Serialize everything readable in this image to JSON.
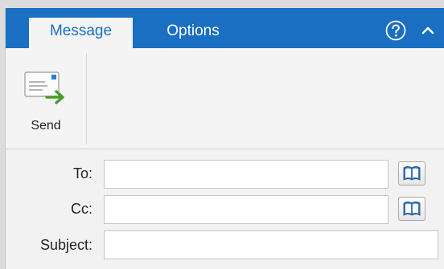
{
  "tabs": [
    {
      "label": "Message",
      "active": true
    },
    {
      "label": "Options",
      "active": false
    }
  ],
  "header": {
    "icons": [
      "help-icon",
      "collapse-ribbon-icon"
    ],
    "accent_color": "#1a6fc3"
  },
  "ribbon": {
    "send": {
      "label": "Send",
      "icon": "send-envelope-icon"
    }
  },
  "fields": {
    "to": {
      "label": "To:",
      "value": "",
      "icon": "address-book-icon"
    },
    "cc": {
      "label": "Cc:",
      "value": "",
      "icon": "address-book-icon"
    },
    "subject": {
      "label": "Subject:",
      "value": ""
    }
  }
}
